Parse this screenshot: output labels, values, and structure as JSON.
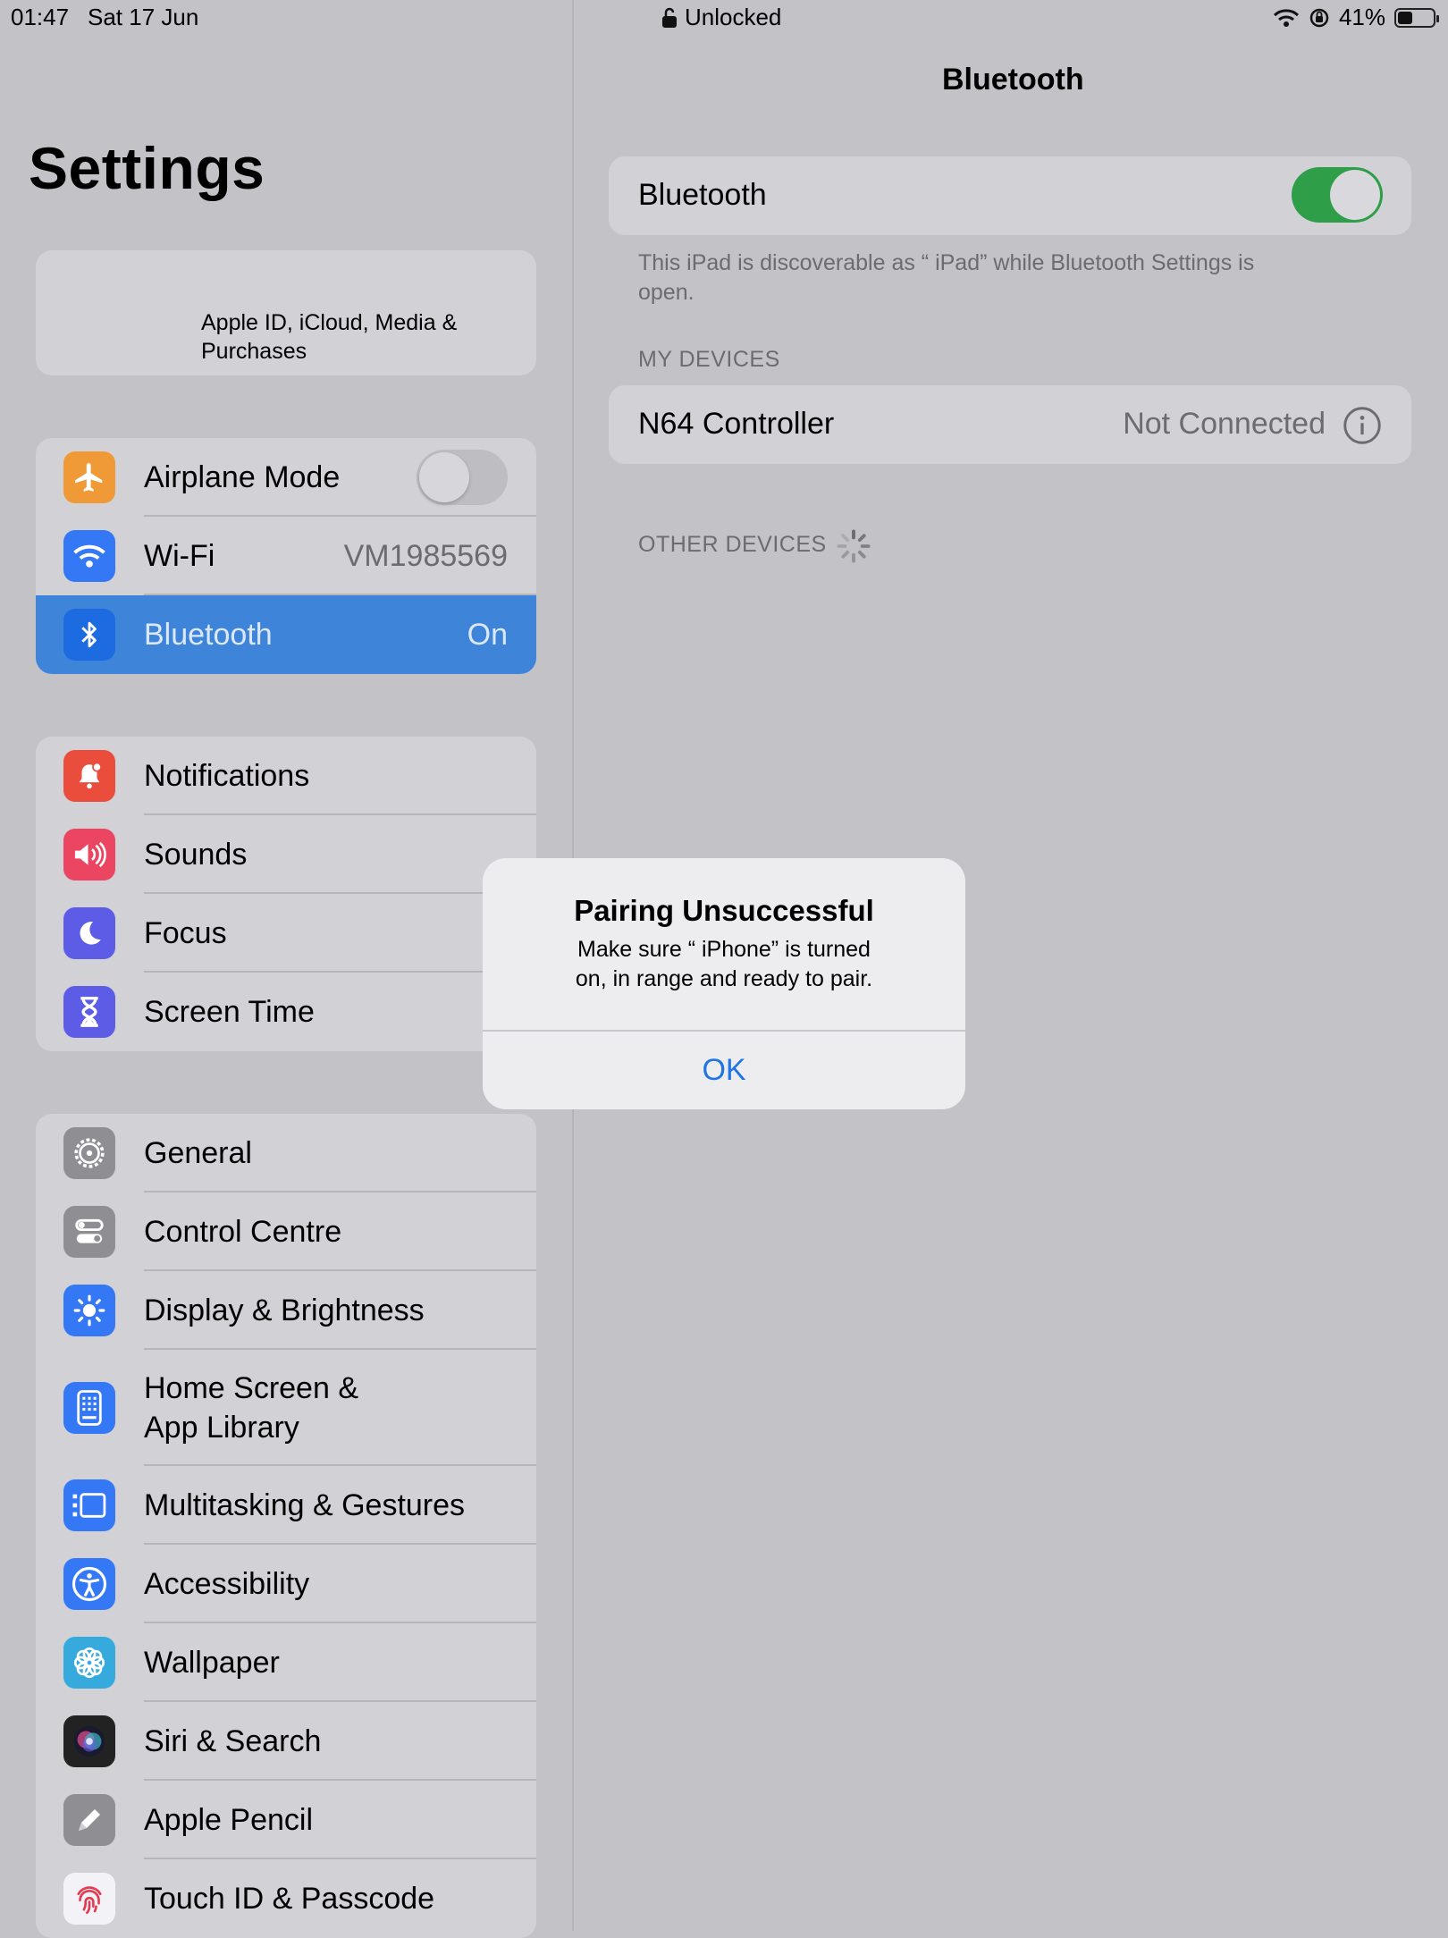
{
  "status_bar": {
    "time": "01:47",
    "date": "Sat 17 Jun",
    "lock_text": "Unlocked",
    "battery": "41%",
    "battery_level": 0.41
  },
  "sidebar": {
    "title": "Settings",
    "profile_subtitle": "Apple ID, iCloud, Media & Purchases",
    "group1": [
      {
        "label": "Airplane Mode",
        "icon": "airplane-icon",
        "color": "#f09a37",
        "toggle": false
      },
      {
        "label": "Wi-Fi",
        "value": "VM1985569",
        "icon": "wifi-icon",
        "color": "#3478f6"
      },
      {
        "label": "Bluetooth",
        "value": "On",
        "icon": "bluetooth-icon",
        "color": "#3478f6",
        "selected": true
      }
    ],
    "group2": [
      {
        "label": "Notifications",
        "icon": "bell-icon",
        "color": "#eb4d3d"
      },
      {
        "label": "Sounds",
        "icon": "speaker-icon",
        "color": "#eb4561"
      },
      {
        "label": "Focus",
        "icon": "moon-icon",
        "color": "#5d5ce6"
      },
      {
        "label": "Screen Time",
        "icon": "hourglass-icon",
        "color": "#5d5ce6"
      }
    ],
    "group3": [
      {
        "label": "General",
        "icon": "gear-icon",
        "color": "#8e8e93"
      },
      {
        "label": "Control Centre",
        "icon": "switches-icon",
        "color": "#8e8e93"
      },
      {
        "label": "Display & Brightness",
        "icon": "sun-icon",
        "color": "#3478f6"
      },
      {
        "label": "Home Screen &",
        "label2": "App Library",
        "icon": "home-grid-icon",
        "color": "#3478f6"
      },
      {
        "label": "Multitasking & Gestures",
        "icon": "multitasking-icon",
        "color": "#3478f6"
      },
      {
        "label": "Accessibility",
        "icon": "accessibility-icon",
        "color": "#3478f6"
      },
      {
        "label": "Wallpaper",
        "icon": "flower-icon",
        "color": "#36aadc"
      },
      {
        "label": "Siri & Search",
        "icon": "siri-icon",
        "color": "#222222"
      },
      {
        "label": "Apple Pencil",
        "icon": "pencil-icon",
        "color": "#8e8e93"
      },
      {
        "label": "Touch ID & Passcode",
        "icon": "fingerprint-icon",
        "color": "#f2f2f7"
      }
    ]
  },
  "detail": {
    "nav_title": "Bluetooth",
    "bluetooth_label": "Bluetooth",
    "bluetooth_on": true,
    "discoverable_line1": "This iPad is discoverable as “            iPad” while Bluetooth Settings is",
    "discoverable_line2": "open.",
    "my_devices_header": "MY DEVICES",
    "device_name": "N64 Controller",
    "device_status": "Not Connected",
    "other_devices_header": "OTHER DEVICES"
  },
  "alert": {
    "title": "Pairing Unsuccessful",
    "message_line1": "Make sure “           iPhone” is turned",
    "message_line2": "on, in range and ready to pair.",
    "ok_label": "OK"
  },
  "colors": {
    "accent": "#1f74e6",
    "toggle_on": "#2e9e49",
    "selected_row": "#3e85d9"
  }
}
